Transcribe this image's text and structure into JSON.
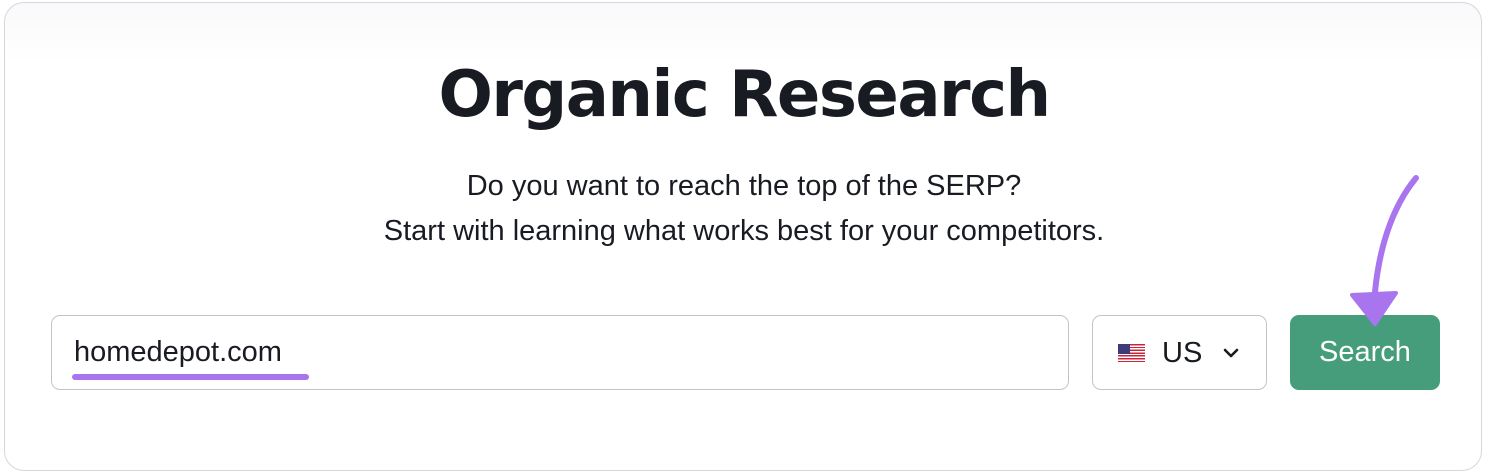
{
  "header": {
    "title": "Organic Research",
    "subtitle_line1": "Do you want to reach the top of the SERP?",
    "subtitle_line2": "Start with learning what works best for your competitors."
  },
  "search_form": {
    "domain_value": "homedepot.com",
    "database": {
      "selected": "US",
      "flag_icon": "us-flag-icon"
    },
    "submit_label": "Search"
  },
  "colors": {
    "button": "#469d7c",
    "highlight": "#a875ef",
    "text": "#191b23",
    "border": "#c2c4cc"
  }
}
